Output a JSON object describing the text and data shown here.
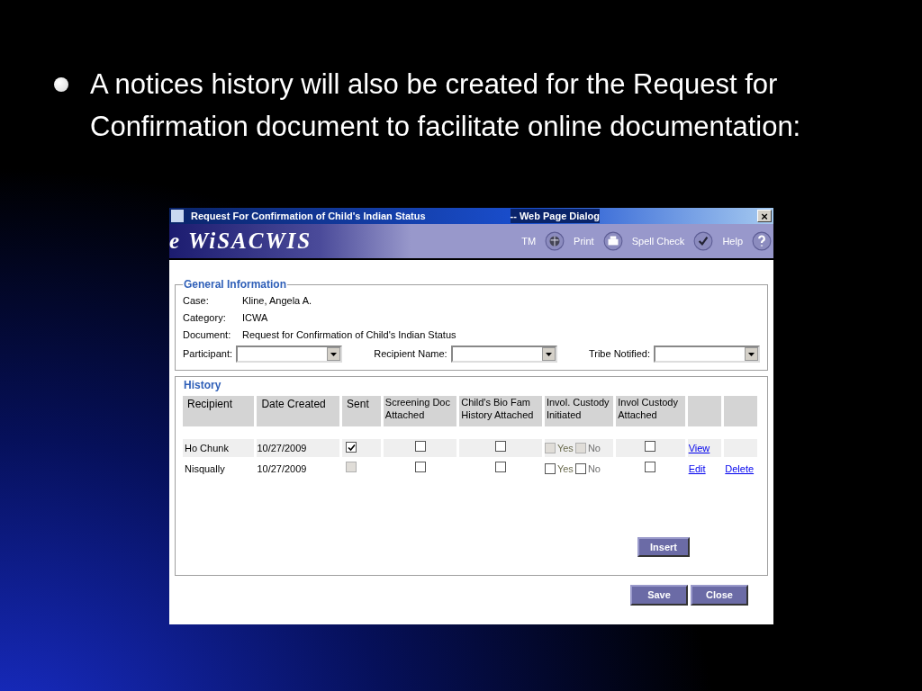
{
  "slide": {
    "bullet": "A notices history will also be created for the Request for Confirmation document to facilitate online documentation:"
  },
  "dialog": {
    "title": "Request For Confirmation of Child's Indian Status",
    "title_suffix": "-- Web Page Dialog",
    "close": "×",
    "banner": {
      "logo": "e WiSACWIS",
      "links": [
        "TM",
        "Print",
        "Spell Check",
        "Help"
      ]
    },
    "general": {
      "legend": "General Information",
      "fields": [
        {
          "label": "Case:",
          "value": "Kline, Angela A."
        },
        {
          "label": "Category:",
          "value": "ICWA"
        },
        {
          "label": "Document:",
          "value": "Request for Confirmation of Child's Indian Status"
        }
      ],
      "selects": [
        {
          "label": "Participant:"
        },
        {
          "label": "Recipient Name:"
        },
        {
          "label": "Tribe Notified:"
        }
      ]
    },
    "history": {
      "legend": "History",
      "columns": [
        "Recipient",
        "Date Created",
        "Sent",
        "Screening Doc Attached",
        "Child's Bio Fam History Attached",
        "Invol. Custody Initiated",
        "Invol Custody Attached"
      ],
      "rows": [
        {
          "recipient": "Ho Chunk",
          "date": "10/27/2009",
          "shaded": true,
          "sent": {
            "checked": true,
            "disabled": false
          },
          "screening": {
            "checked": false
          },
          "bio": {
            "checked": false
          },
          "initiated": {
            "yes_label": "Yes",
            "no_label": "No",
            "yes": false,
            "no": false,
            "disabled": true
          },
          "attached": {
            "checked": false
          },
          "links": [
            "View"
          ]
        },
        {
          "recipient": "Nisqually",
          "date": "10/27/2009",
          "shaded": false,
          "sent": {
            "checked": false,
            "disabled": true
          },
          "screening": {
            "checked": false
          },
          "bio": {
            "checked": false
          },
          "initiated": {
            "yes_label": "Yes",
            "no_label": "No",
            "yes": false,
            "no": false,
            "disabled": false
          },
          "attached": {
            "checked": false
          },
          "links": [
            "Edit",
            "Delete"
          ]
        }
      ],
      "insert": "Insert"
    },
    "buttons": [
      "Save",
      "Close"
    ]
  }
}
